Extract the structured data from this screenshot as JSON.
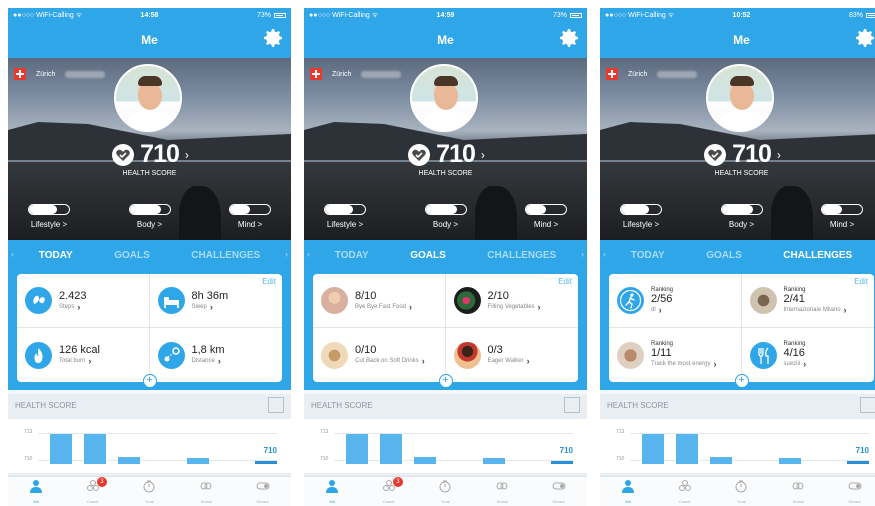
{
  "colors": {
    "primary": "#2fa6e8",
    "badge": "#e8392f",
    "text_dark": "#222222"
  },
  "screens": [
    {
      "status": {
        "carrier": "●●○○○ WiFi-Calling ᯤ",
        "time": "14:58",
        "battery": "73%"
      },
      "nav_title": "Me",
      "location": "Zürich",
      "health_score": "710",
      "health_score_label": "HEALTH SCORE",
      "categories": [
        {
          "label": "Lifestyle >",
          "fill": 0.7
        },
        {
          "label": "Body >",
          "fill": 0.78
        },
        {
          "label": "Mind >",
          "fill": 0.5
        }
      ],
      "tabs": [
        "TODAY",
        "GOALS",
        "CHALLENGES"
      ],
      "active_tab": 0,
      "edit_label": "Edit",
      "cells": [
        {
          "rank": "",
          "value": "2.423",
          "sub": "Steps",
          "icon": "steps-icon",
          "photo": ""
        },
        {
          "rank": "",
          "value": "8h 36m",
          "sub": "Sleep",
          "icon": "sleep-icon",
          "photo": ""
        },
        {
          "rank": "",
          "value": "126 kcal",
          "sub": "Total burn",
          "icon": "flame-icon",
          "photo": ""
        },
        {
          "rank": "",
          "value": "1,8 km",
          "sub": "Distance",
          "icon": "distance-icon",
          "photo": ""
        }
      ],
      "health_score_section": "HEALTH SCORE",
      "chart_current": "710",
      "tabbar": [
        "Me",
        "Coach",
        "Goal",
        "Social",
        "Device"
      ],
      "badge_count": "3"
    },
    {
      "status": {
        "carrier": "●●○○○ WiFi-Calling ᯤ",
        "time": "14:59",
        "battery": "73%"
      },
      "nav_title": "Me",
      "location": "Zürich",
      "health_score": "710",
      "health_score_label": "HEALTH SCORE",
      "categories": [
        {
          "label": "Lifestyle >",
          "fill": 0.7
        },
        {
          "label": "Body >",
          "fill": 0.78
        },
        {
          "label": "Mind >",
          "fill": 0.5
        }
      ],
      "tabs": [
        "TODAY",
        "GOALS",
        "CHALLENGES"
      ],
      "active_tab": 1,
      "edit_label": "Edit",
      "cells": [
        {
          "rank": "",
          "value": "8/10",
          "sub": "Bye Bye Fast Food",
          "icon": "",
          "photo": "ph-a"
        },
        {
          "rank": "",
          "value": "2/10",
          "sub": "Filling Vegetables",
          "icon": "",
          "photo": "ph-b"
        },
        {
          "rank": "",
          "value": "0/10",
          "sub": "Cut Back on Soft Drinks",
          "icon": "",
          "photo": "ph-c"
        },
        {
          "rank": "",
          "value": "0/3",
          "sub": "Eager Walker",
          "icon": "",
          "photo": "ph-d"
        }
      ],
      "health_score_section": "HEALTH SCORE",
      "chart_current": "710",
      "tabbar": [
        "Me",
        "Coach",
        "Goal",
        "Social",
        "Device"
      ],
      "badge_count": "3"
    },
    {
      "status": {
        "carrier": "●●○○○ WiFi-Calling ᯤ",
        "time": "10:52",
        "battery": "83%"
      },
      "nav_title": "Me",
      "location": "Zürich",
      "health_score": "710",
      "health_score_label": "HEALTH SCORE",
      "categories": [
        {
          "label": "Lifestyle >",
          "fill": 0.7
        },
        {
          "label": "Body >",
          "fill": 0.78
        },
        {
          "label": "Mind >",
          "fill": 0.5
        }
      ],
      "tabs": [
        "TODAY",
        "GOALS",
        "CHALLENGES"
      ],
      "active_tab": 2,
      "edit_label": "Edit",
      "cells": [
        {
          "rank": "Ranking",
          "value": "2/56",
          "sub": "dl",
          "icon": "runner-icon",
          "photo": ""
        },
        {
          "rank": "Ranking",
          "value": "2/41",
          "sub": "Internazionale Milano",
          "icon": "",
          "photo": "ph-e"
        },
        {
          "rank": "Ranking",
          "value": "1/11",
          "sub": "Track the most energy",
          "icon": "",
          "photo": "ph-f"
        },
        {
          "rank": "Ranking",
          "value": "4/16",
          "sub": "sueziii",
          "icon": "fork-knife-icon",
          "photo": ""
        }
      ],
      "health_score_section": "HEALTH SCORE",
      "chart_current": "710",
      "tabbar": [
        "Me",
        "Coach",
        "Goal",
        "Social",
        "Device"
      ],
      "badge_count": ""
    }
  ],
  "chart_data": {
    "type": "bar",
    "ylabel": "",
    "ytick_labels": [
      "713",
      "710"
    ],
    "values": [
      713,
      713,
      710.4,
      0,
      710.3,
      0,
      710
    ],
    "ylim": [
      709.6,
      713.5
    ],
    "current_label": "710"
  }
}
